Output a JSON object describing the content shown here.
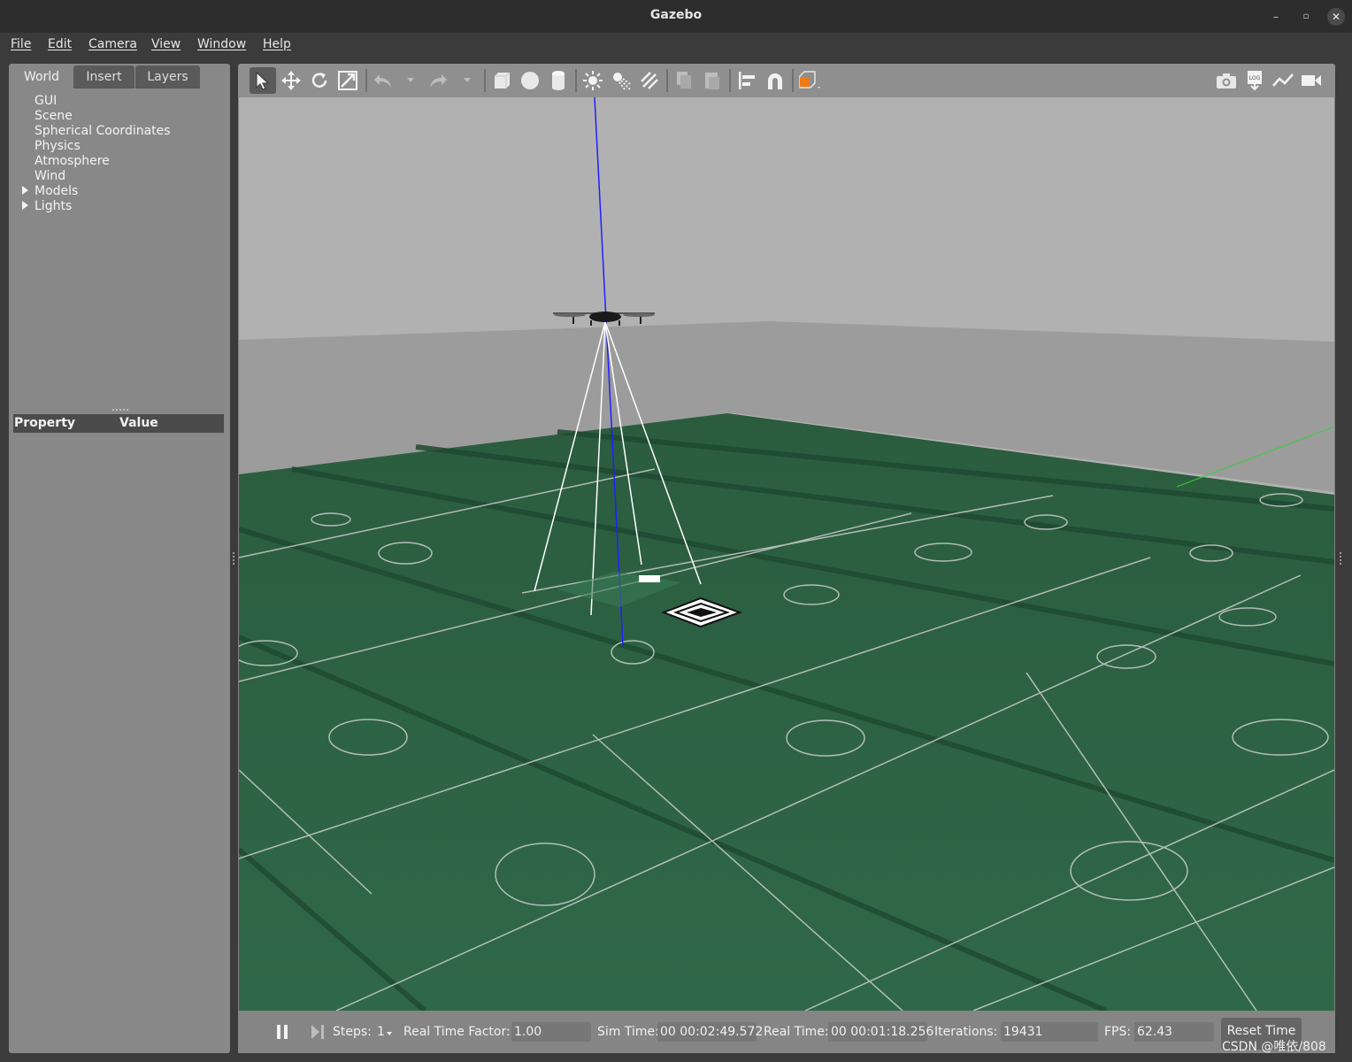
{
  "window": {
    "title": "Gazebo"
  },
  "menu": [
    "File",
    "Edit",
    "Camera",
    "View",
    "Window",
    "Help"
  ],
  "left_panel": {
    "tabs": [
      "World",
      "Insert",
      "Layers"
    ],
    "active_tab": "World",
    "tree": [
      "GUI",
      "Scene",
      "Spherical Coordinates",
      "Physics",
      "Atmosphere",
      "Wind",
      "Models",
      "Lights"
    ],
    "expandable": [
      "Models",
      "Lights"
    ],
    "property_header": {
      "property": "Property",
      "value": "Value"
    }
  },
  "toolbar": {
    "left": [
      "select-mode-icon",
      "translate-mode-icon",
      "rotate-mode-icon",
      "scale-mode-icon",
      "undo-icon",
      "redo-icon",
      "box-icon",
      "sphere-icon",
      "cylinder-icon",
      "point-light-icon",
      "spot-light-icon",
      "directional-light-icon",
      "copy-icon",
      "paste-icon",
      "align-icon",
      "snap-icon",
      "view-angle-icon"
    ],
    "right": [
      "screenshot-icon",
      "log-icon",
      "plot-icon",
      "record-video-icon"
    ],
    "active_tool": "select-mode-icon",
    "accent": "#f07a12"
  },
  "scene": {
    "sky": "#b0b0b0",
    "wall": "#9c9c9c",
    "ground": "#2f6545",
    "field_lines": "#d8d8d8",
    "z_axis": "#1f1fff",
    "y_axis": "#37d037"
  },
  "bottom_bar": {
    "steps_label": "Steps:",
    "steps_value": "1",
    "rtf_label": "Real Time Factor:",
    "rtf_value": "1.00",
    "sim_time_label": "Sim Time:",
    "sim_time_value": "00 00:02:49.572",
    "real_time_label": "Real Time:",
    "real_time_value": "00 00:01:18.256",
    "iterations_label": "Iterations:",
    "iterations_value": "19431",
    "fps_label": "FPS:",
    "fps_value": "62.43",
    "reset_label": "Reset Time"
  },
  "watermark": "CSDN @唯依/808"
}
